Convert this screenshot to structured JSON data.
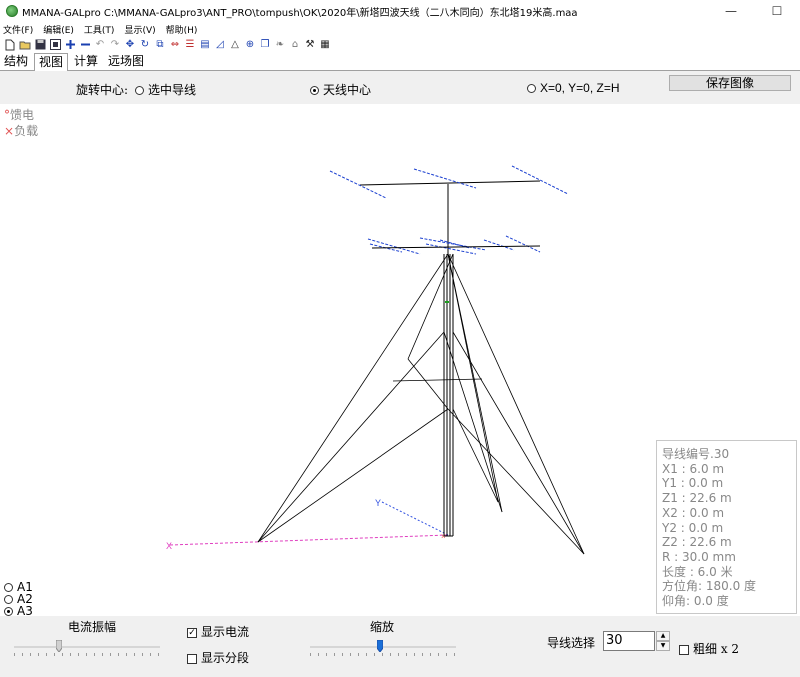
{
  "titlebar": {
    "title": "MMANA-GALpro C:\\MMANA-GALpro3\\ANT_PRO\\tompush\\OK\\2020年\\新塔四波天线（二八木同向）东北塔19米高.maa",
    "minimize": "—",
    "maximize": "☐"
  },
  "menu": [
    "文件(F)",
    "编辑(E)",
    "工具(T)",
    "显示(V)",
    "帮助(H)"
  ],
  "toolbar_icons": [
    "new-icon",
    "open-icon",
    "save-icon",
    "saveas-icon",
    "add-icon",
    "remove-icon",
    "undo-icon",
    "redo-icon",
    "move-icon",
    "rotate-icon",
    "copy-icon",
    "stretch-icon",
    "wire-icon",
    "doc-icon",
    "graph-icon",
    "triangle-icon",
    "target-icon",
    "copy2-icon",
    "leaf-icon",
    "home-icon",
    "tools-icon",
    "calc-icon"
  ],
  "tabs": [
    {
      "label": "结构",
      "active": false
    },
    {
      "label": "视图",
      "active": true
    },
    {
      "label": "计算",
      "active": false
    },
    {
      "label": "远场图",
      "active": false
    }
  ],
  "rotation": {
    "label": "旋转中心:",
    "options": [
      {
        "label": "选中导线",
        "selected": false
      },
      {
        "label": "天线中心",
        "selected": true
      },
      {
        "label": "X=0, Y=0, Z=H",
        "selected": false
      }
    ],
    "save_button": "保存图像"
  },
  "legend": {
    "feed_marker": "°",
    "feed_label": "馈电",
    "load_marker": "×",
    "load_label": "负载"
  },
  "axis_labels": {
    "x": "X",
    "y": "Y"
  },
  "info_panel": {
    "lines": [
      "导线编号.30",
      "X1  :  6.0 m",
      "Y1  :  0.0 m",
      "Z1  : 22.6 m",
      "X2  :  0.0 m",
      "Y2  :  0.0 m",
      "Z2  : 22.6 m",
      "R    : 30.0 mm",
      "长度 : 6.0 米",
      "方位角: 180.0 度",
      "仰角: 0.0 度"
    ]
  },
  "views": [
    {
      "label": "A1",
      "selected": false
    },
    {
      "label": "A2",
      "selected": false
    },
    {
      "label": "A3",
      "selected": true
    }
  ],
  "bottom": {
    "current_label": "电流振幅",
    "current_level": 0.3,
    "show_current": {
      "label": "显示电流",
      "checked": true
    },
    "show_segments": {
      "label": "显示分段",
      "checked": false
    },
    "zoom_label": "缩放",
    "zoom_level": 0.48,
    "wire_select_label": "导线选择",
    "wire_select_value": "30",
    "thick_label": "粗细 x 2",
    "thick_checked": false
  },
  "colors": {
    "wire": "#000000",
    "current": "#1a3fd0",
    "ground_axis": "#e040c0",
    "y_axis": "#3050e0",
    "feed": "#e05050",
    "mast_green": "#20a020"
  }
}
